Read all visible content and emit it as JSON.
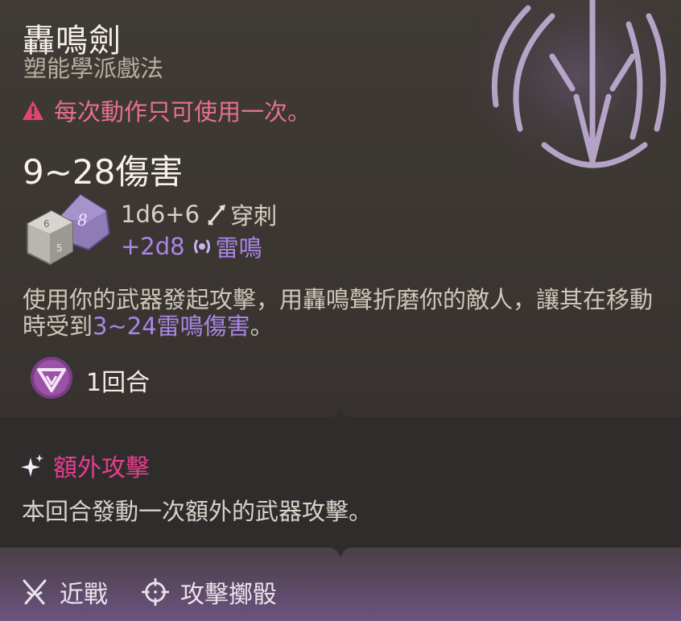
{
  "spell": {
    "name": "轟鳴劍",
    "school": "塑能學派戲法",
    "warning": "每次動作只可使用一次。",
    "damage_total": "9~28傷害",
    "damage_lines": [
      {
        "dice": "1d6+6",
        "type": "穿刺"
      },
      {
        "dice": "+2d8",
        "type": "雷鳴"
      }
    ],
    "description_prefix": "使用你的武器發起攻擊，用轟鳴聲折磨你的敵人，讓其在移動時受到",
    "description_highlight": "3~24雷鳴傷害",
    "description_suffix": "。",
    "duration": "1回合"
  },
  "extra": {
    "title": "額外攻擊",
    "description": "本回合發動一次額外的武器攻擊。"
  },
  "tags": [
    {
      "label": "近戰",
      "icon": "crossed-swords-icon"
    },
    {
      "label": "攻擊擲骰",
      "icon": "target-icon"
    }
  ],
  "colors": {
    "warning": "#e86f92",
    "thunder": "#a986e6",
    "extra_title": "#e83d8f"
  }
}
